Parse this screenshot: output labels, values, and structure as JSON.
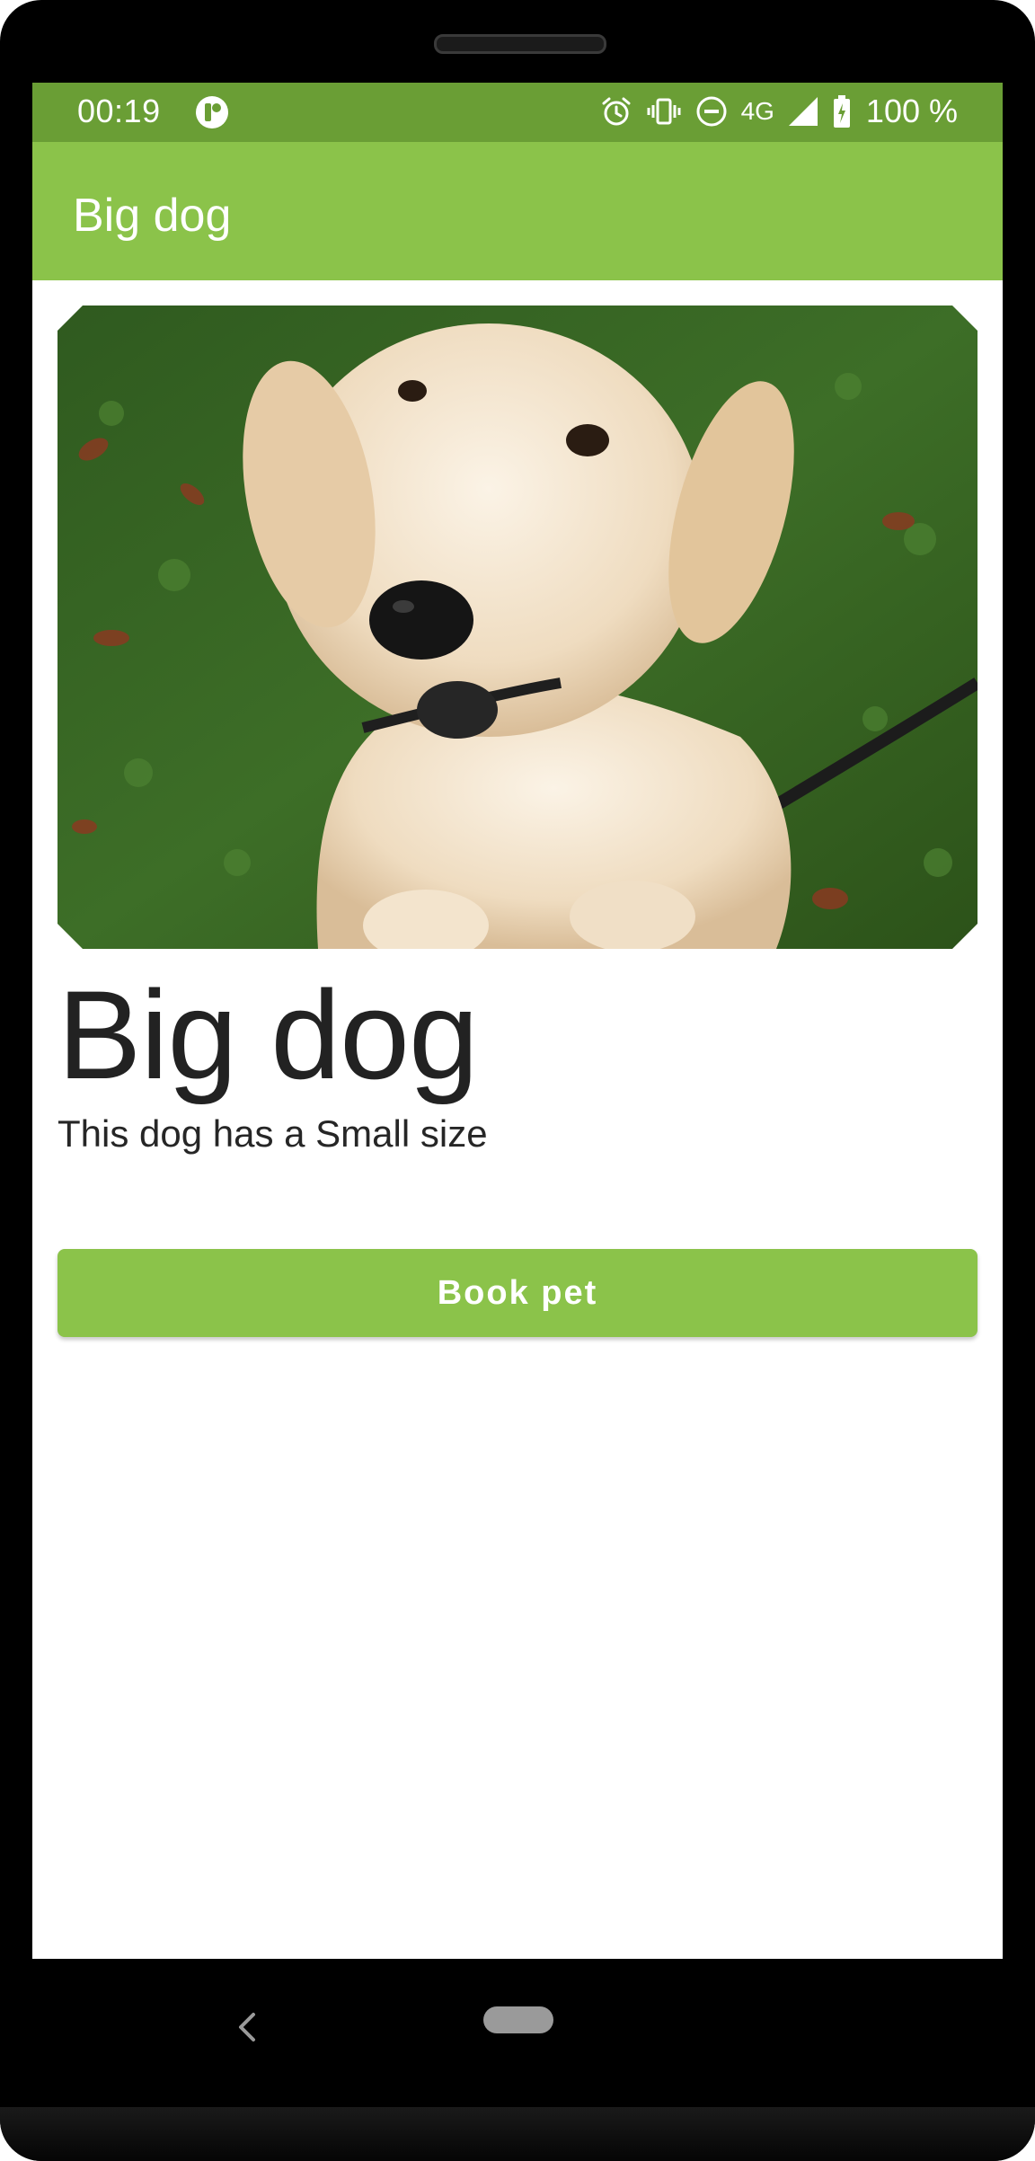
{
  "status_bar": {
    "time": "00:19",
    "network": "4G",
    "battery": "100 %",
    "icons": [
      "app-notification-icon",
      "alarm-icon",
      "vibrate-icon",
      "do-not-disturb-icon",
      "signal-icon",
      "battery-charging-icon"
    ]
  },
  "app_bar": {
    "title": "Big dog"
  },
  "pet": {
    "name": "Big dog",
    "description": "This dog has a Small size",
    "image": "dog-photo"
  },
  "actions": {
    "book_label": "Book pet"
  },
  "nav": {
    "icons": [
      "back-icon",
      "home-pill"
    ]
  },
  "colors": {
    "status_bar": "#6a9e35",
    "app_bar": "#8bc34a",
    "button": "#8bc34a",
    "text": "#222222"
  }
}
